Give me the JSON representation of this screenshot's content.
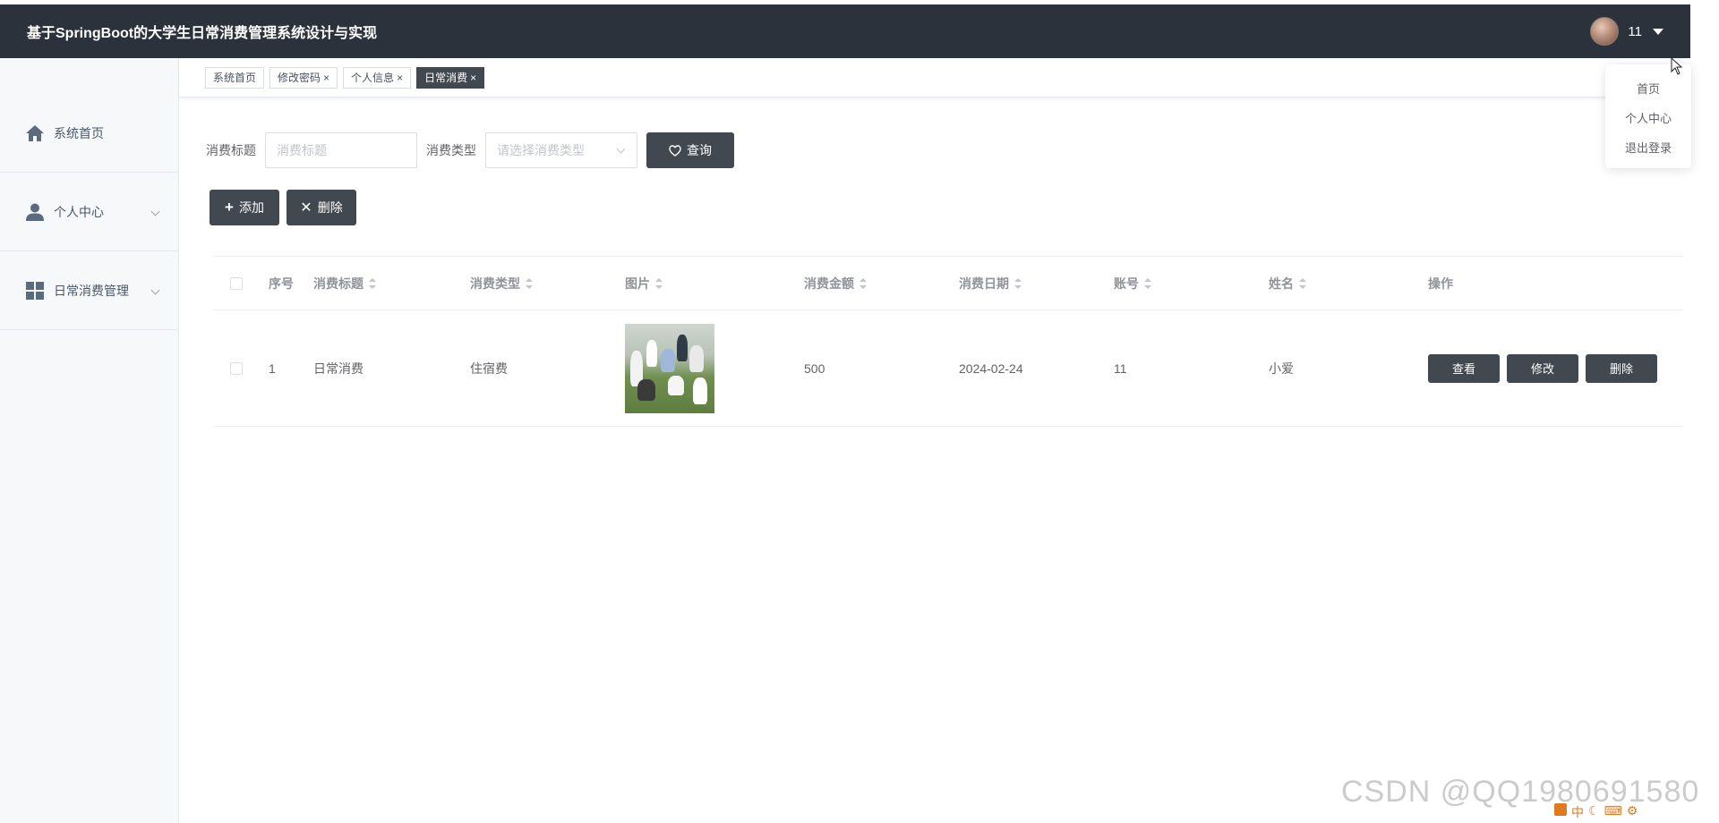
{
  "header": {
    "title": "基于SpringBoot的大学生日常消费管理系统设计与实现",
    "username": "11"
  },
  "user_menu": {
    "items": [
      "首页",
      "个人中心",
      "退出登录"
    ]
  },
  "sidebar": {
    "items": [
      {
        "label": "系统首页",
        "icon": "home-icon"
      },
      {
        "label": "个人中心",
        "icon": "user-icon"
      },
      {
        "label": "日常消费管理",
        "icon": "grid-icon"
      }
    ]
  },
  "tabs": [
    {
      "label": "系统首页",
      "closable": false,
      "active": false
    },
    {
      "label": "修改密码",
      "closable": true,
      "active": false
    },
    {
      "label": "个人信息",
      "closable": true,
      "active": false
    },
    {
      "label": "日常消费",
      "closable": true,
      "active": true
    }
  ],
  "search": {
    "title_label": "消费标题",
    "title_placeholder": "消费标题",
    "type_label": "消费类型",
    "type_placeholder": "请选择消费类型",
    "query_label": "查询"
  },
  "actions": {
    "add_label": "添加",
    "delete_label": "删除"
  },
  "table": {
    "headers": {
      "index": "序号",
      "title": "消费标题",
      "type": "消费类型",
      "image": "图片",
      "amount": "消费金额",
      "date": "消费日期",
      "account": "账号",
      "name": "姓名",
      "ops": "操作"
    },
    "rows": [
      {
        "index": "1",
        "title": "日常消费",
        "type": "住宿费",
        "amount": "500",
        "date": "2024-02-24",
        "account": "11",
        "name": "小爱",
        "view_label": "查看",
        "edit_label": "修改",
        "delete_label": "删除"
      }
    ]
  },
  "watermark": "CSDN @QQ1980691580",
  "tray_text": "中",
  "colors": {
    "header_bg": "#2b323c",
    "button_bg": "#42484f",
    "active_tab_bg": "#42484f"
  }
}
